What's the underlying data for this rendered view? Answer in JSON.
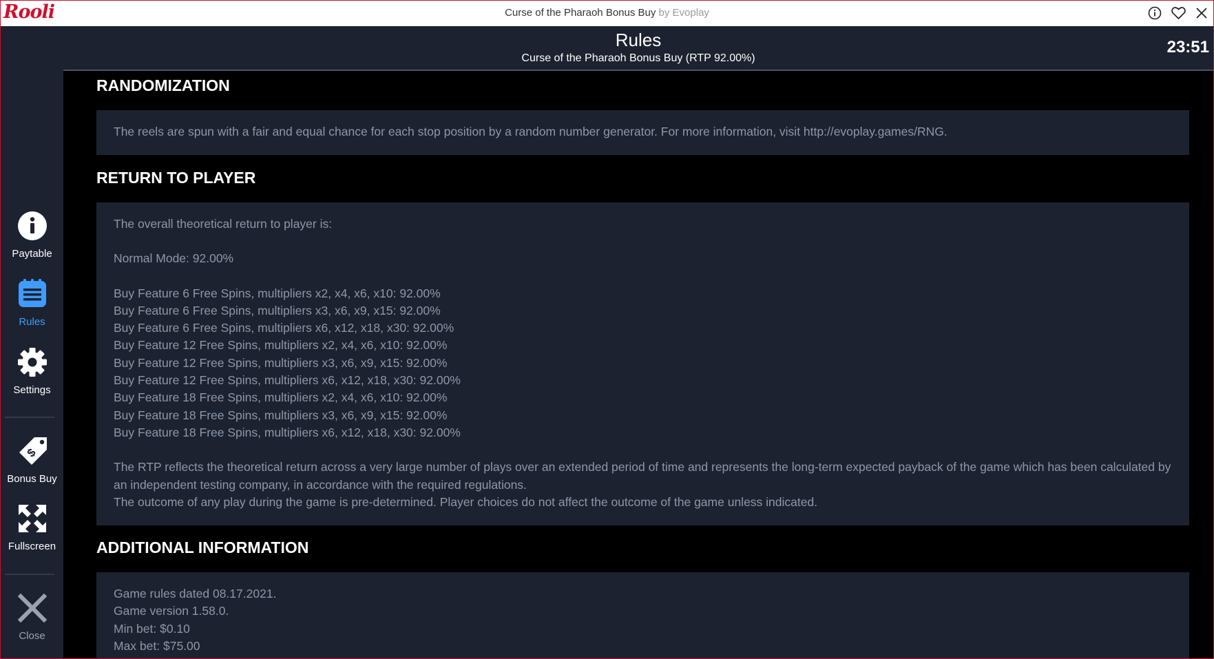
{
  "titlebar": {
    "logo_text": "Rooli",
    "title": "Curse of the Pharaoh Bonus Buy",
    "by": "by Evoplay",
    "icons": [
      "info-icon",
      "heart-icon",
      "close-icon"
    ]
  },
  "sidebar": {
    "items": [
      {
        "label": "Paytable",
        "icon": "info-icon"
      },
      {
        "label": "Rules",
        "icon": "rules-icon",
        "active": true
      },
      {
        "label": "Settings",
        "icon": "gear-icon"
      },
      {
        "label": "Bonus Buy",
        "icon": "bonus-tag-icon"
      },
      {
        "label": "Fullscreen",
        "icon": "fullscreen-icon"
      },
      {
        "label": "Close",
        "icon": "close-x-icon"
      }
    ]
  },
  "header": {
    "title": "Rules",
    "subtitle": "Curse of the Pharaoh Bonus Buy (RTP 92.00%)",
    "time": "23:51"
  },
  "sections": {
    "randomization": {
      "title": "RANDOMIZATION",
      "text": "The reels are spun with a fair and equal chance for each stop position by a random number generator. For more information, visit http://evoplay.games/RNG."
    },
    "rtp": {
      "title": "RETURN TO PLAYER",
      "intro": "The overall theoretical return to player is:",
      "normal": "Normal Mode: 92.00%",
      "features": [
        "Buy Feature 6 Free Spins, multipliers x2, x4, x6, x10: 92.00%",
        "Buy Feature 6 Free Spins, multipliers x3, x6, x9, x15: 92.00%",
        "Buy Feature 6 Free Spins, multipliers x6, x12, x18, x30: 92.00%",
        "Buy Feature 12 Free Spins, multipliers x2, x4, x6, x10: 92.00%",
        "Buy Feature 12 Free Spins, multipliers x3, x6, x9, x15: 92.00%",
        "Buy Feature 12 Free Spins, multipliers x6, x12, x18, x30: 92.00%",
        "Buy Feature 18 Free Spins, multipliers x2, x4, x6, x10: 92.00%",
        "Buy Feature 18 Free Spins, multipliers x3, x6, x9, x15: 92.00%",
        "Buy Feature 18 Free Spins, multipliers x6, x12, x18, x30: 92.00%"
      ],
      "rtp_note": "The RTP reflects the theoretical return across a very large number of plays over an extended period of time and represents the long-term expected payback of the game which has been calculated by an independent testing company, in accordance with the required regulations.",
      "outcome_note": "The outcome of any play during the game is pre-determined. Player choices do not affect the outcome of the game unless indicated."
    },
    "additional": {
      "title": "ADDITIONAL INFORMATION",
      "lines": [
        "Game rules dated 08.17.2021.",
        "Game version 1.58.0.",
        "Min bet: $0.10",
        "Max bet: $75.00"
      ]
    }
  },
  "colors": {
    "brand_red": "#d0102e",
    "sidebar_bg": "#1c2230",
    "active_blue": "#3f9bff",
    "body_text": "#8d97a8"
  }
}
